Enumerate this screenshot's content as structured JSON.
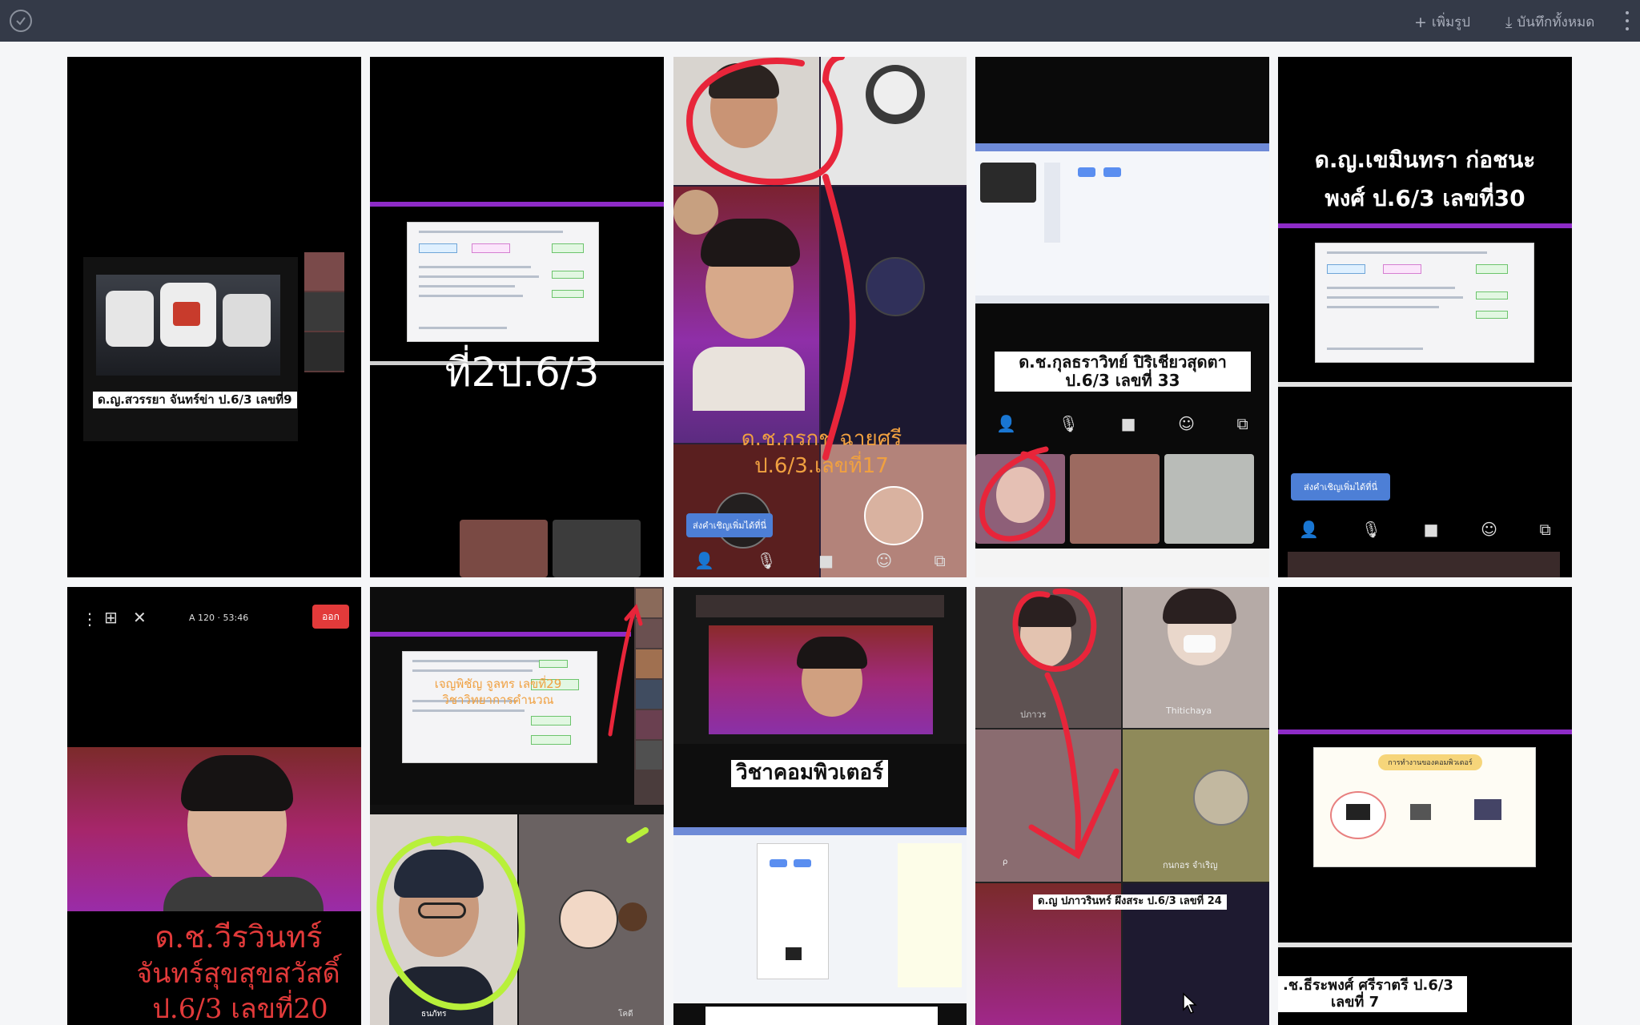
{
  "toolbar": {
    "add_image_label": "เพิ่มรูป",
    "save_all_label": "บันทึกทั้งหมด"
  },
  "tiles": {
    "t1": {
      "caption": "ด.ญ.สวรรยา จันทร์ข่า ป.6/3 เลขที่9"
    },
    "t2": {
      "big_line2": "ที่2ป.6/3"
    },
    "t3": {
      "overlay_line1": "ด.ช.กรกช ฉายศรี",
      "overlay_line2": "ป.6/3.เลขที่17",
      "invite_pill": "ส่งคำเชิญเพิ่มได้ที่นี่"
    },
    "t4": {
      "caption_line1": "ด.ช.กุลธราวิทย์ ปิริเชียวสุดตา",
      "caption_line2": "ป.6/3 เลขที่ 33"
    },
    "t5": {
      "title_line1": "ด.ญ.เขมินทรา ก่อชนะ",
      "title_line2": "พงศ์ ป.6/3 เลขที่30",
      "invite_pill": "ส่งคำเชิญเพิ่มได้ที่นี่"
    },
    "t6": {
      "status": "A 120 · 53:46",
      "leave_button": "ออก",
      "name_line1": "ด.ช.วีรวินทร์",
      "name_line2": "จันทร์สุขสุขสวัสดิ์",
      "name_line3": "ป.6/3 เลขที่20"
    },
    "t7": {
      "overlay_line1": "เจญพิชัญ จูลทร เลขที่29",
      "overlay_line2": "วิชาวิทยาการคำนวณ",
      "name_label": "ธนภัทร",
      "side_label": "โคดี"
    },
    "t8": {
      "caption": "วิชาคอมพิวเตอร์"
    },
    "t9": {
      "caption": "ด.ญ ปภาวรินทร์ ผึงสระ ป.6/3 เลขที่ 24",
      "label_1": "ปภาวร",
      "label_2": "Thitichaya",
      "label_3": "กนกอร จำเริญ"
    },
    "t10": {
      "caption_line1": ".ช.ธีระพงศ์ ศรีราตรี ป.6/3",
      "caption_line2": "เลขที่ 7",
      "doc_title": "การทำงานของคอมพิวเตอร์"
    }
  },
  "colors": {
    "topbar": "#343a48",
    "page_bg": "#f5f6f8",
    "annotation_red": "#e8253a",
    "annotation_green": "#b8f03a",
    "zoom_purple": "#8e2bc7"
  }
}
